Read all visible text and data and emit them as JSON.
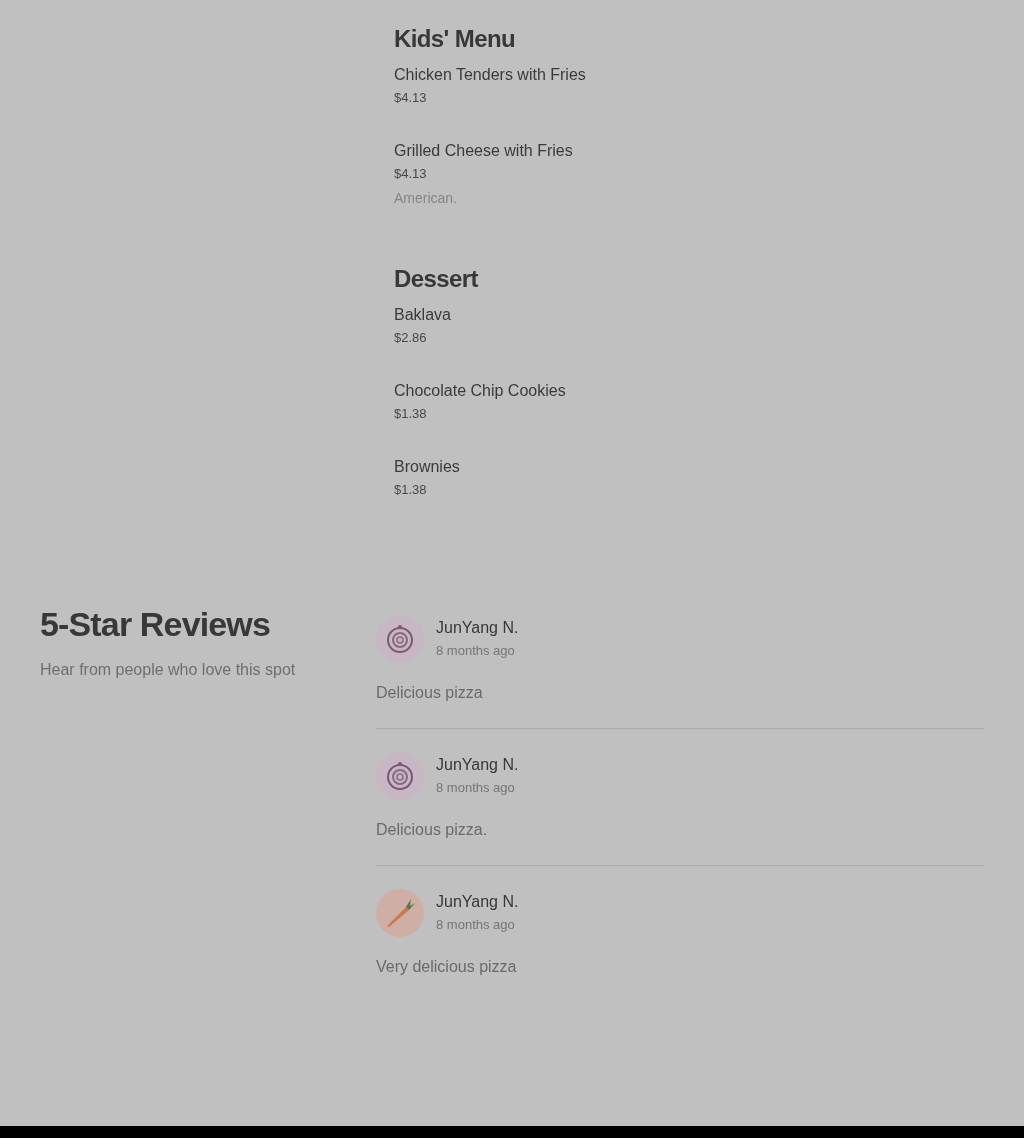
{
  "menu_sections": [
    {
      "title": "Kids' Menu",
      "items": [
        {
          "name": "Chicken Tenders with Fries",
          "price": "$4.13"
        },
        {
          "name": "Grilled Cheese with Fries",
          "price": "$4.13",
          "description": "American."
        }
      ]
    },
    {
      "title": "Dessert",
      "items": [
        {
          "name": "Baklava",
          "price": "$2.86"
        },
        {
          "name": "Chocolate Chip Cookies",
          "price": "$1.38"
        },
        {
          "name": "Brownies",
          "price": "$1.38"
        }
      ]
    }
  ],
  "reviews_section": {
    "title": "5-Star Reviews",
    "subtitle": "Hear from people who love this spot",
    "reviews": [
      {
        "avatar": {
          "kind": "rings"
        },
        "author": "JunYang N.",
        "time": "8 months ago",
        "text": "Delicious pizza"
      },
      {
        "avatar": {
          "kind": "rings"
        },
        "author": "JunYang N.",
        "time": "8 months ago",
        "text": "Delicious pizza."
      },
      {
        "avatar": {
          "kind": "carrot"
        },
        "author": "JunYang N.",
        "time": "8 months ago",
        "text": "Very delicious pizza"
      }
    ]
  }
}
